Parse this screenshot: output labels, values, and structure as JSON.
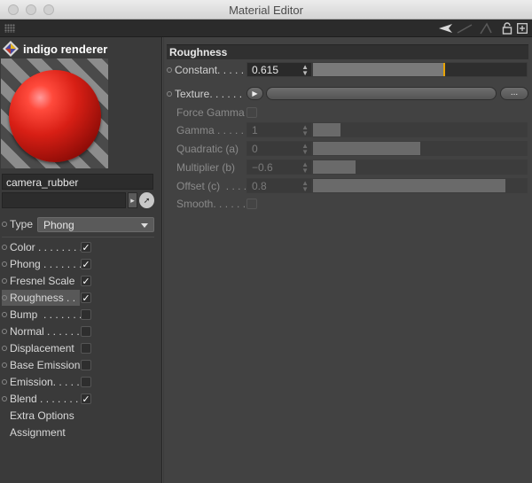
{
  "window": {
    "title": "Material Editor"
  },
  "toolbar": {
    "icons": [
      "back-arrow-icon",
      "forward-arrow-icon",
      "up-arrow-icon",
      "lock-icon",
      "new-window-icon"
    ]
  },
  "brand": {
    "name": "indigo renderer",
    "logo": "indigo-logo-icon"
  },
  "material": {
    "name": "camera_rubber"
  },
  "type": {
    "label": "Type",
    "value": "Phong"
  },
  "channels": [
    {
      "label": "Color . . . . . . . .",
      "checked": true
    },
    {
      "label": "Phong . . . . . . .",
      "checked": true
    },
    {
      "label": "Fresnel Scale",
      "checked": true
    },
    {
      "label": "Roughness . .",
      "checked": true,
      "selected": true
    },
    {
      "label": "Bump  . . . . . . .",
      "checked": false
    },
    {
      "label": "Normal . . . . . .",
      "checked": false
    },
    {
      "label": "Displacement",
      "checked": false
    },
    {
      "label": "Base Emission",
      "checked": false
    },
    {
      "label": "Emission. . . . .",
      "checked": false
    },
    {
      "label": "Blend . . . . . . . .",
      "checked": true
    },
    {
      "label": "Extra Options"
    },
    {
      "label": "Assignment"
    }
  ],
  "roughness": {
    "header": "Roughness",
    "constant": {
      "label": "Constant. . . . .",
      "value": "0.615",
      "fraction": 0.615
    },
    "texture": {
      "label": "Texture. . . . . .",
      "browse": "..."
    },
    "force_gamma": {
      "label": "Force Gamma",
      "checked": false
    },
    "gamma": {
      "label": "Gamma . . . . . .",
      "value": "1",
      "fraction": 0.13
    },
    "quadratic": {
      "label": "Quadratic (a)",
      "value": "0",
      "fraction": 0.5
    },
    "multiplier": {
      "label": "Multiplier (b)",
      "value": "−0.6",
      "fraction": 0.2
    },
    "offset": {
      "label": "Offset (c)  . . . .",
      "value": "0.8",
      "fraction": 0.9
    },
    "smooth": {
      "label": "Smooth. . . . . .",
      "checked": false
    }
  }
}
